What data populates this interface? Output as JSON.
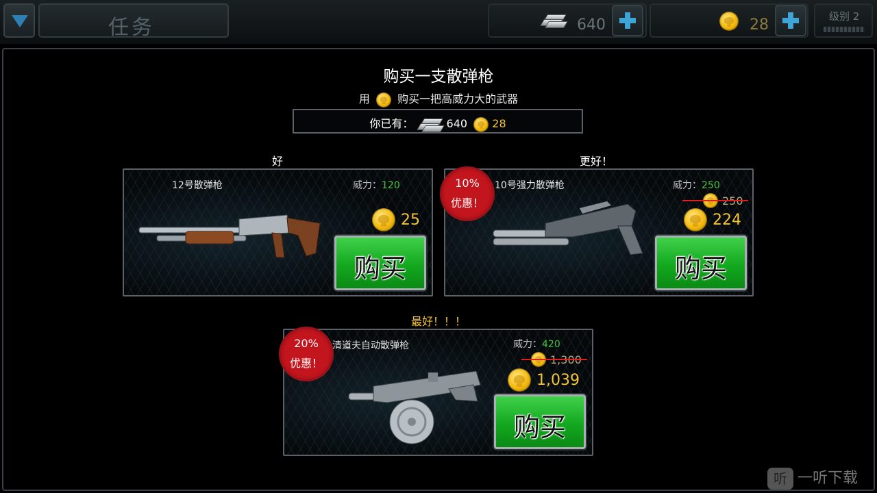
{
  "topbar": {
    "menu_title": "任务",
    "silver_amount": "640",
    "gold_amount": "28",
    "level_label": "级别 2"
  },
  "dialog": {
    "title": "购买一支散弹枪",
    "subtitle_prefix": "用",
    "subtitle_suffix": "购买一把高威力大的武器",
    "owned_label": "你已有：",
    "owned_silver": "640",
    "owned_gold": "28"
  },
  "offers": [
    {
      "tier_label": "好",
      "name": "12号散弹枪",
      "power_label": "威力：",
      "power_value": "120",
      "price": "25",
      "buy_label": "购买"
    },
    {
      "tier_label": "更好！",
      "name": "10号强力散弹枪",
      "power_label": "威力：",
      "power_value": "250",
      "old_price": "250",
      "price": "224",
      "discount_top": "10%",
      "discount_bottom": "优惠！",
      "buy_label": "购买"
    },
    {
      "tier_label": "最好！！！",
      "name": "清道夫自动散弹枪",
      "power_label": "威力：",
      "power_value": "420",
      "old_price": "1,300",
      "price": "1,039",
      "discount_top": "20%",
      "discount_bottom": "优惠！",
      "buy_label": "购买"
    }
  ],
  "watermark": {
    "logo_glyph": "听",
    "text": "一听下载"
  },
  "colors": {
    "gold_text": "#f3c437",
    "power_green": "#47c43b",
    "buy_green": "#13a81f",
    "discount_red": "#c2151d",
    "topbar_plus": "#3fa4d6"
  },
  "icons": [
    "dropdown-arrow-icon",
    "silver-bars-icon",
    "gold-skull-coin-icon",
    "plus-icon",
    "level-bar-icon"
  ]
}
